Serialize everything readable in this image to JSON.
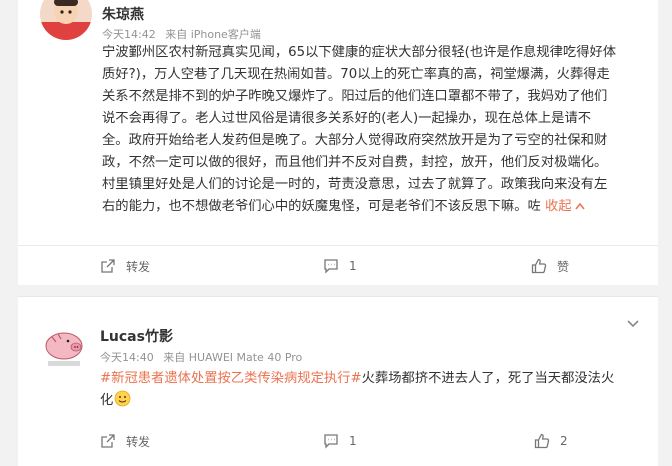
{
  "comments": [
    {
      "author": "朱琼燕",
      "time": "今天14:42",
      "source": "来自 iPhone客户端",
      "lines": [
        "宁波鄞州区农村新冠真实见闻，65以下健康的症状大部分很轻(也许是作息规律吃得好体",
        "质好?)，万人空巷了几天现在热闹如昔。70以上的死亡率真的高，祠堂爆满，火葬得走",
        "关系不然是排不到的炉子昨晚又爆炸了。阳过后的他们连口罩都不带了，我妈劝了他们",
        "说不会再得了。老人过世风俗是请很多关系好的(老人)一起操办，现在总体上是请不",
        "全。政府开始给老人发药但是晚了。大部分人觉得政府突然放开是为了亏空的社保和财",
        "政，不然一定可以做的很好，而且他们并不反对自费，封控，放开，他们反对极端化。",
        "村里镇里好处是人们的讨论是一时的，苛责没意思，过去了就算了。政策我向来没有左",
        "右的能力，也不想做老爷们心中的妖魔鬼怪，可是老爷们不该反思下嘛。咗"
      ],
      "collapse_label": "收起",
      "forward_label": "转发",
      "comment_count": "1",
      "like_label": "赞"
    },
    {
      "author": "Lucas竹影",
      "time": "今天14:40",
      "source": "来自 HUAWEI Mate 40 Pro",
      "hashtag": "#新冠患者遗体处置按乙类传染病规定执行#",
      "text_line1": "火葬场都挤不进去人了，死了当天都没法火",
      "text_line2": "化",
      "forward_label": "转发",
      "comment_count": "1",
      "like_count": "2"
    }
  ],
  "colors": {
    "accent": "#eb7350",
    "meta": "#939393"
  },
  "icons": [
    "forward-icon",
    "comment-icon",
    "like-icon",
    "chevron-up-icon",
    "chevron-down-icon",
    "emoji-smile-icon"
  ]
}
